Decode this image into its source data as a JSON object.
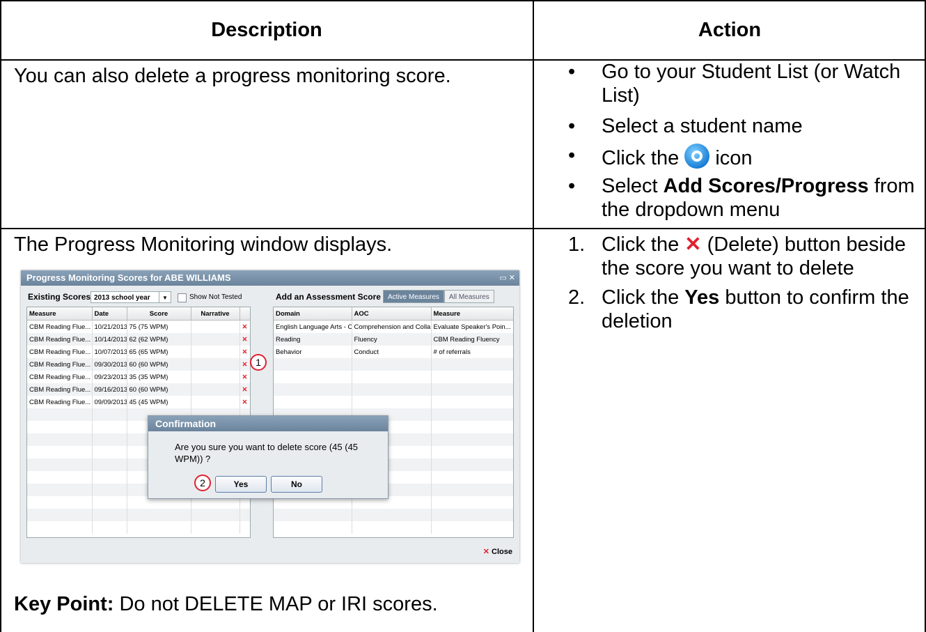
{
  "table": {
    "header_description": "Description",
    "header_action": "Action",
    "row1": {
      "description": "You can also delete a progress monitoring score.",
      "bullets": {
        "b1": "Go to your Student List (or Watch List)",
        "b2": "Select a student name",
        "b3_pre": "Click the",
        "b3_post": "icon",
        "b4_bold": "Add Scores/Progress",
        "b4_pre": "Select",
        "b4_post": "from the dropdown menu"
      }
    },
    "row2": {
      "description": "The Progress Monitoring window displays.",
      "key_point_label": "Key Point:",
      "key_point_text": "Do not DELETE MAP or IRI scores.",
      "steps": {
        "s1_num": "1.",
        "s1_pre": "Click the",
        "s1_post": "(Delete) button beside the score you want to delete",
        "s2_num": "2.",
        "s2_pre": "Click the",
        "s2_bold": "Yes",
        "s2_post": "button to confirm the deletion"
      }
    }
  },
  "screenshot": {
    "window_title": "Progress Monitoring Scores for ABE WILLIAMS",
    "existing_scores_label": "Existing Scores",
    "year_select_value": "2013 school year",
    "show_not_tested_label": "Show Not Tested",
    "add_score_label": "Add an Assessment Score",
    "tab_active": "Active Measures",
    "tab_all": "All Measures",
    "left_columns": [
      "Measure",
      "Date",
      "Score",
      "Narrative"
    ],
    "left_rows": [
      {
        "measure": "CBM Reading Flue...",
        "date": "10/21/2013",
        "score": "75 (75 WPM)"
      },
      {
        "measure": "CBM Reading Flue...",
        "date": "10/14/2013",
        "score": "62 (62 WPM)"
      },
      {
        "measure": "CBM Reading Flue...",
        "date": "10/07/2013",
        "score": "65 (65 WPM)"
      },
      {
        "measure": "CBM Reading Flue...",
        "date": "09/30/2013",
        "score": "60 (60 WPM)"
      },
      {
        "measure": "CBM Reading Flue...",
        "date": "09/23/2013",
        "score": "35 (35 WPM)"
      },
      {
        "measure": "CBM Reading Flue...",
        "date": "09/16/2013",
        "score": "60 (60 WPM)"
      },
      {
        "measure": "CBM Reading Flue...",
        "date": "09/09/2013",
        "score": "45 (45 WPM)"
      }
    ],
    "right_columns": [
      "Domain",
      "AOC",
      "Measure"
    ],
    "right_rows": [
      {
        "domain": "English Language Arts - C",
        "aoc": "Comprehension and Colla",
        "measure": "Evaluate Speaker's Poin..."
      },
      {
        "domain": "Reading",
        "aoc": "Fluency",
        "measure": "CBM Reading Fluency"
      },
      {
        "domain": "Behavior",
        "aoc": "Conduct",
        "measure": "# of referrals"
      }
    ],
    "badge_1": "1",
    "badge_2": "2",
    "dialog_title": "Confirmation",
    "dialog_message": "Are you sure you want to delete score (45 (45 WPM)) ?",
    "yes_label": "Yes",
    "no_label": "No",
    "close_label": "Close",
    "delete_glyph": "✕"
  },
  "colors": {
    "delete_red": "#e0202e",
    "title_bar": "#6b849c"
  }
}
